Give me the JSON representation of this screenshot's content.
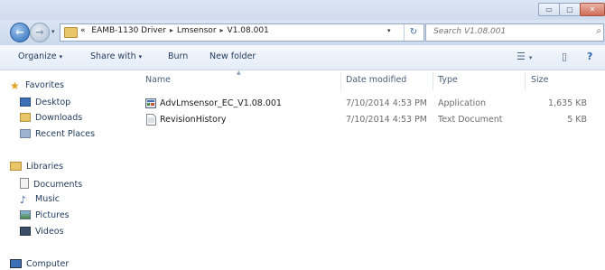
{
  "window": {
    "controls": {
      "minimize": "▭",
      "maximize": "▢",
      "close": "✕"
    }
  },
  "address": {
    "prefix": "«",
    "crumbs": [
      "EAMB-1130 Driver",
      "Lmsensor",
      "V1.08.001"
    ],
    "separator": "▸",
    "dropdown": "▾",
    "refresh": "↻"
  },
  "search": {
    "placeholder": "Search V1.08.001",
    "icon": "⌕"
  },
  "toolbar": {
    "organize": "Organize",
    "share_with": "Share with",
    "burn": "Burn",
    "new_folder": "New folder",
    "caret": "▾"
  },
  "nav": {
    "favorites": {
      "header": "Favorites",
      "items": [
        "Desktop",
        "Downloads",
        "Recent Places"
      ]
    },
    "libraries": {
      "header": "Libraries",
      "items": [
        "Documents",
        "Music",
        "Pictures",
        "Videos"
      ]
    },
    "computer": {
      "header": "Computer"
    }
  },
  "columns": {
    "name": "Name",
    "date": "Date modified",
    "type": "Type",
    "size": "Size"
  },
  "files": [
    {
      "name": "AdvLmsensor_EC_V1.08.001",
      "date": "7/10/2014 4:53 PM",
      "type": "Application",
      "size": "1,635 KB",
      "icon": "application-icon"
    },
    {
      "name": "RevisionHistory",
      "date": "7/10/2014 4:53 PM",
      "type": "Text Document",
      "size": "5 KB",
      "icon": "text-document-icon"
    }
  ],
  "colors": {
    "accent": "#1e395b",
    "toolbar_bg": "#e4ecf7",
    "folder": "#e9c56a"
  }
}
